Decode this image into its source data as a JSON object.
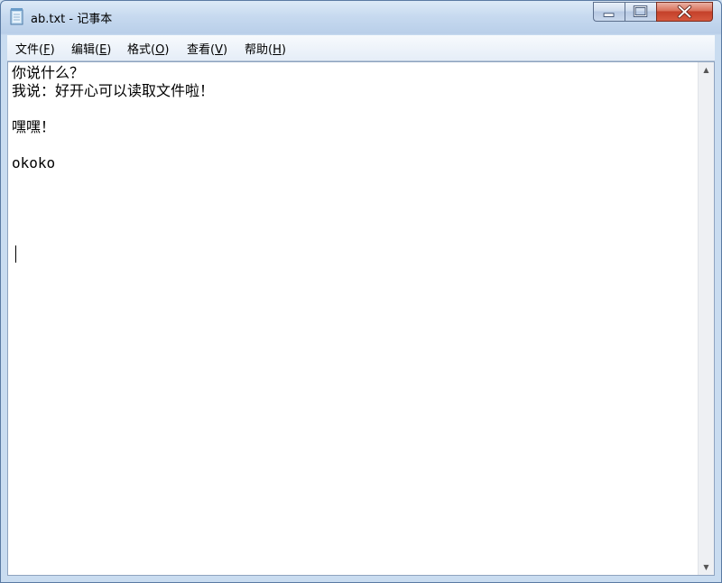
{
  "window": {
    "title": "ab.txt - 记事本",
    "icon": "notepad-icon"
  },
  "menu": [
    {
      "label": "文件(",
      "key": "F",
      "end": ")"
    },
    {
      "label": "编辑(",
      "key": "E",
      "end": ")"
    },
    {
      "label": "格式(",
      "key": "O",
      "end": ")"
    },
    {
      "label": "查看(",
      "key": "V",
      "end": ")"
    },
    {
      "label": "帮助(",
      "key": "H",
      "end": ")"
    }
  ],
  "document": {
    "lines": [
      "你说什么？",
      "我说：好开心可以读取文件啦！",
      "",
      "嘿嘿！",
      "",
      "okoko",
      "",
      "",
      "",
      ""
    ]
  }
}
